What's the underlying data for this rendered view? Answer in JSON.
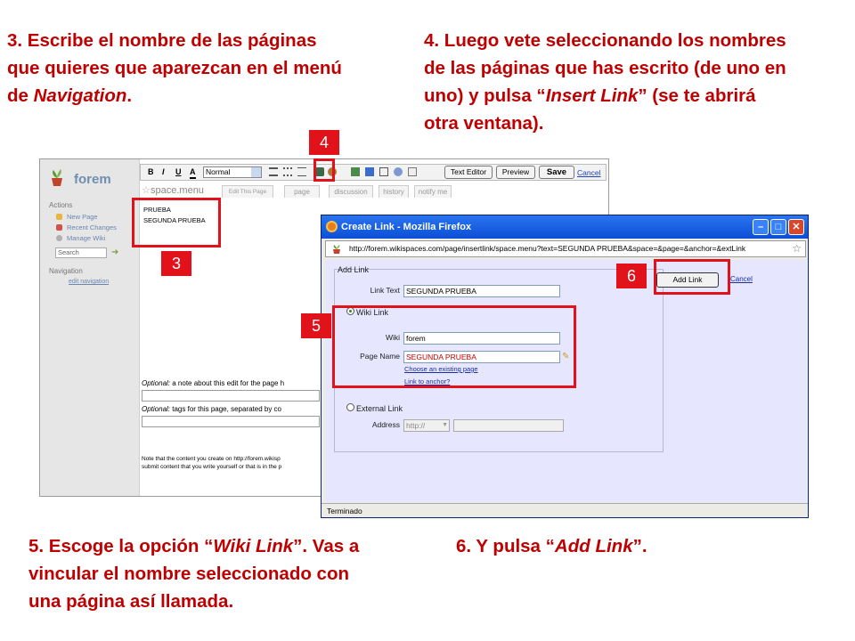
{
  "captions": {
    "step3": [
      "3. Escribe el nombre de las páginas",
      "que quieres que aparezcan en el menú",
      "de "
    ],
    "step3_italic": "Navigation",
    "step3_end": ".",
    "step4": [
      "4. Luego vete seleccionando los nombres",
      "de las páginas que has escrito (de uno en",
      "uno) y pulsa “",
      "” (se te abrirá",
      "otra ventana)."
    ],
    "step4_italic": "Insert Link",
    "step5": [
      "5. Escoge la opción “",
      "”. Vas a",
      "vincular el nombre seleccionado con",
      "una página así llamada."
    ],
    "step5_italic": "Wiki Link",
    "step6": [
      "6. Y pulsa “",
      "”."
    ],
    "step6_italic": "Add Link"
  },
  "badges": {
    "b3": "3",
    "b4": "4",
    "b5": "5",
    "b6": "6"
  },
  "wiki": {
    "logo": "forem",
    "actions_title": "Actions",
    "actions": [
      "New Page",
      "Recent Changes",
      "Manage Wiki"
    ],
    "search_placeholder": "Search",
    "navigation_title": "Navigation",
    "edit_navigation": "edit navigation",
    "toolbar": {
      "bold": "B",
      "italic": "I",
      "underline": "U",
      "color": "A",
      "format": "Normal",
      "text_editor": "Text Editor",
      "preview": "Preview",
      "save": "Save",
      "cancel": "Cancel"
    },
    "page_name": "space.menu",
    "tabs": [
      "Edit This Page",
      "page",
      "discussion",
      "history",
      "notify me"
    ],
    "editor_lines": [
      "PRUEBA",
      "SEGUNDA PRUEBA"
    ],
    "optional_note_label": "Optional:",
    "optional_note_text": " a note about this edit for the page h",
    "optional_tags_label": "Optional:",
    "optional_tags_text": " tags for this page, separated by co",
    "footer_lines": [
      "Note that the content you create on http://forem.wikisp",
      "submit content that you write yourself or that is in the p"
    ]
  },
  "dialog": {
    "title": "Create Link - Mozilla Firefox",
    "url": "http://forem.wikispaces.com/page/insertlink/space.menu?text=SEGUNDA PRUEBA&space=&page=&anchor=&extLink",
    "legend": "Add Link",
    "link_text_label": "Link Text",
    "link_text_value": "SEGUNDA PRUEBA",
    "wiki_link_label": "Wiki Link",
    "wiki_label": "Wiki",
    "wiki_value": "forem",
    "page_name_label": "Page Name",
    "page_name_value": "SEGUNDA PRUEBA",
    "choose_page": "Choose an existing page",
    "link_anchor": "Link to anchor?",
    "external_link_label": "External Link",
    "address_label": "Address",
    "address_value": "http://",
    "add_link_button": "Add Link",
    "cancel": "Cancel",
    "status": "Terminado"
  },
  "colors": {
    "annotation_red": "#e2121a",
    "caption_red": "#c00000",
    "dialog_bg": "#e6e6ff"
  }
}
